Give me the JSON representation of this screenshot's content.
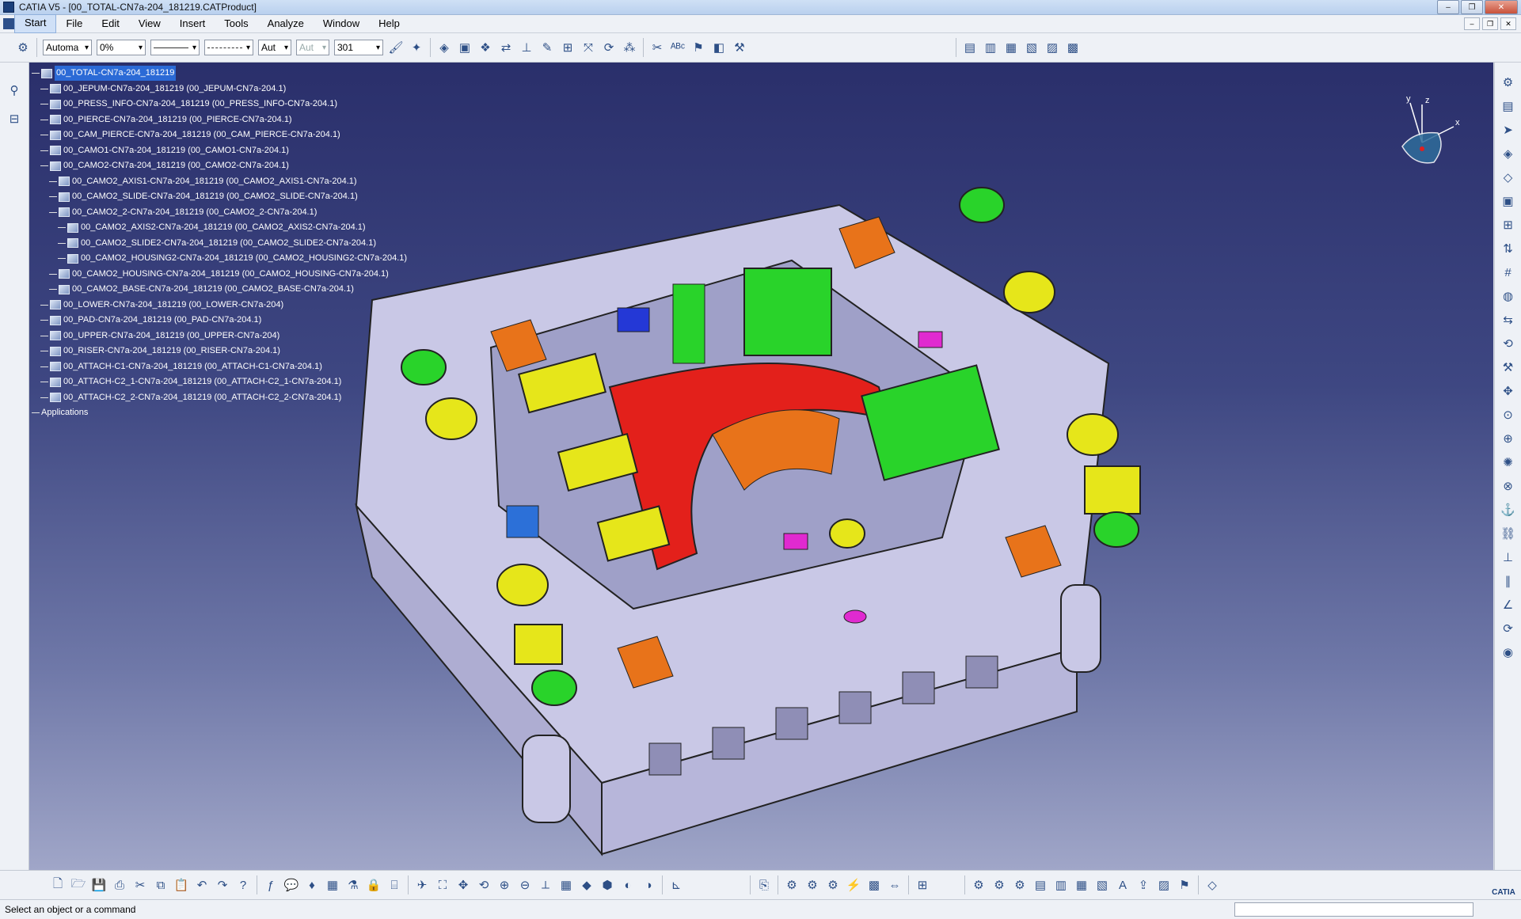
{
  "window": {
    "title": "CATIA V5 - [00_TOTAL-CN7a-204_181219.CATProduct]"
  },
  "menu": [
    "Start",
    "File",
    "Edit",
    "View",
    "Insert",
    "Tools",
    "Analyze",
    "Window",
    "Help"
  ],
  "toolbar": {
    "layer_value": "Automa",
    "transparency_value": "0%",
    "linetype_value": "Aut",
    "thickness_value": "Aut",
    "point_value": "301"
  },
  "tree": [
    {
      "label": "00_TOTAL-CN7a-204_181219",
      "level": 0,
      "root": true
    },
    {
      "label": "00_JEPUM-CN7a-204_181219 (00_JEPUM-CN7a-204.1)",
      "level": 1
    },
    {
      "label": "00_PRESS_INFO-CN7a-204_181219 (00_PRESS_INFO-CN7a-204.1)",
      "level": 1
    },
    {
      "label": "00_PIERCE-CN7a-204_181219 (00_PIERCE-CN7a-204.1)",
      "level": 1
    },
    {
      "label": "00_CAM_PIERCE-CN7a-204_181219 (00_CAM_PIERCE-CN7a-204.1)",
      "level": 1
    },
    {
      "label": "00_CAMO1-CN7a-204_181219 (00_CAMO1-CN7a-204.1)",
      "level": 1
    },
    {
      "label": "00_CAMO2-CN7a-204_181219 (00_CAMO2-CN7a-204.1)",
      "level": 1
    },
    {
      "label": "00_CAMO2_AXIS1-CN7a-204_181219 (00_CAMO2_AXIS1-CN7a-204.1)",
      "level": 2
    },
    {
      "label": "00_CAMO2_SLIDE-CN7a-204_181219 (00_CAMO2_SLIDE-CN7a-204.1)",
      "level": 2
    },
    {
      "label": "00_CAMO2_2-CN7a-204_181219 (00_CAMO2_2-CN7a-204.1)",
      "level": 2
    },
    {
      "label": "00_CAMO2_AXIS2-CN7a-204_181219 (00_CAMO2_AXIS2-CN7a-204.1)",
      "level": 3
    },
    {
      "label": "00_CAMO2_SLIDE2-CN7a-204_181219 (00_CAMO2_SLIDE2-CN7a-204.1)",
      "level": 3
    },
    {
      "label": "00_CAMO2_HOUSING2-CN7a-204_181219 (00_CAMO2_HOUSING2-CN7a-204.1)",
      "level": 3
    },
    {
      "label": "00_CAMO2_HOUSING-CN7a-204_181219 (00_CAMO2_HOUSING-CN7a-204.1)",
      "level": 2
    },
    {
      "label": "00_CAMO2_BASE-CN7a-204_181219 (00_CAMO2_BASE-CN7a-204.1)",
      "level": 2
    },
    {
      "label": "00_LOWER-CN7a-204_181219 (00_LOWER-CN7a-204)",
      "level": 1
    },
    {
      "label": "00_PAD-CN7a-204_181219 (00_PAD-CN7a-204.1)",
      "level": 1
    },
    {
      "label": "00_UPPER-CN7a-204_181219 (00_UPPER-CN7a-204)",
      "level": 1
    },
    {
      "label": "00_RISER-CN7a-204_181219 (00_RISER-CN7a-204.1)",
      "level": 1
    },
    {
      "label": "00_ATTACH-C1-CN7a-204_181219 (00_ATTACH-C1-CN7a-204.1)",
      "level": 1
    },
    {
      "label": "00_ATTACH-C2_1-CN7a-204_181219 (00_ATTACH-C2_1-CN7a-204.1)",
      "level": 1
    },
    {
      "label": "00_ATTACH-C2_2-CN7a-204_181219 (00_ATTACH-C2_2-CN7a-204.1)",
      "level": 1
    },
    {
      "label": "Applications",
      "level": 0,
      "plain": true
    }
  ],
  "compass": {
    "x": "x",
    "y": "y",
    "z": "z"
  },
  "status": {
    "message": "Select an object or a command"
  },
  "colors": {
    "background_top": "#2a2f6b",
    "background_bottom": "#a0a6c8",
    "tree_selection": "#2b6ad6",
    "model_base": "#c9c8e6",
    "model_red": "#e3201b",
    "model_green": "#29d32a",
    "model_yellow": "#e6e61a",
    "model_orange": "#e8731a",
    "model_magenta": "#e02ad0"
  },
  "logo_text": "CATIA"
}
